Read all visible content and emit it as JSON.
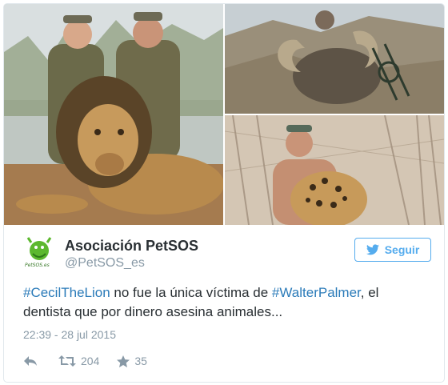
{
  "photos": {
    "main_alt": "Lion hunt photo",
    "ram_alt": "Ram hunt photo",
    "leopard_alt": "Leopard hunt photo"
  },
  "author": {
    "name": "Asociación PetSOS",
    "handle": "@PetSOS_es",
    "avatar_caption": "PetSOS.es"
  },
  "follow_label": "Seguir",
  "tweet": {
    "part1": "#CecilTheLion",
    "part2": " no fue la única víctima de ",
    "part3": "#WalterPalmer",
    "part4": ", el dentista que por dinero asesina animales..."
  },
  "timestamp": "22:39 - 28 jul 2015",
  "stats": {
    "retweets": "204",
    "favorites": "35"
  },
  "colors": {
    "link": "#2b7bb9",
    "accent": "#55acee",
    "muted": "#8899a6",
    "text": "#292f33"
  }
}
